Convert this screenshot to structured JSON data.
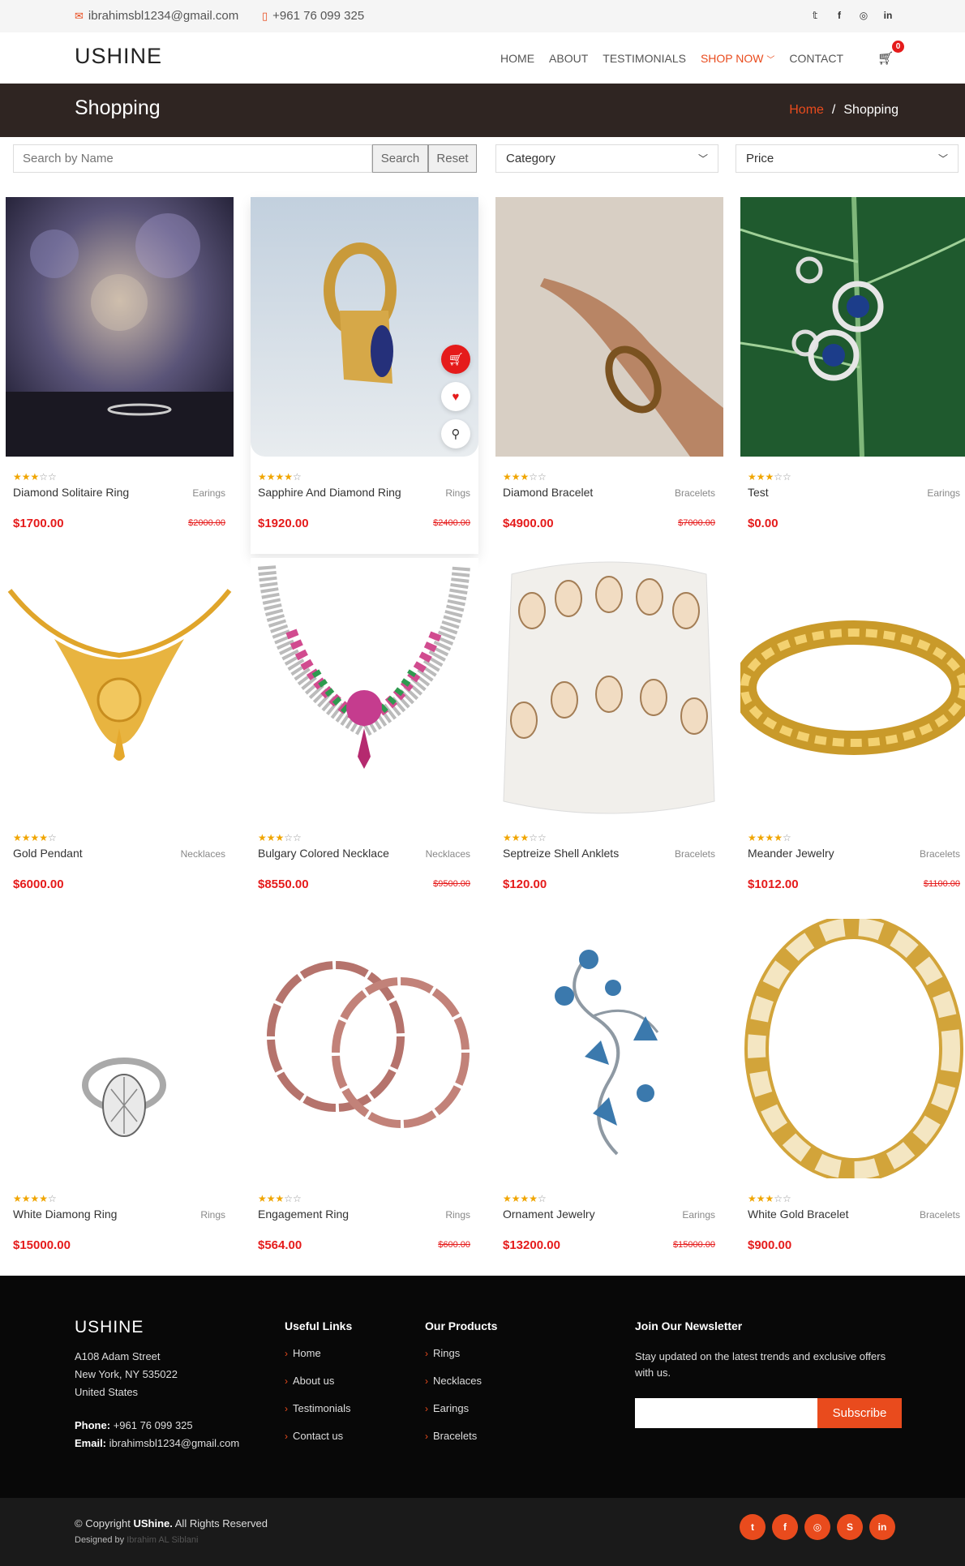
{
  "topbar": {
    "email": "ibrahimsbl1234@gmail.com",
    "phone": "+961 76 099 325",
    "social": [
      "twitter-icon",
      "facebook-icon",
      "instagram-icon",
      "linkedin-icon"
    ]
  },
  "header": {
    "logo": "USHINE",
    "nav": [
      {
        "label": "HOME",
        "active": false
      },
      {
        "label": "ABOUT",
        "active": false
      },
      {
        "label": "TESTIMONIALS",
        "active": false
      },
      {
        "label": "SHOP NOW",
        "active": true
      },
      {
        "label": "CONTACT",
        "active": false
      }
    ],
    "cart_count": "0"
  },
  "banner": {
    "title": "Shopping",
    "breadcrumb_home": "Home",
    "breadcrumb_sep": "/",
    "breadcrumb_current": "Shopping"
  },
  "filters": {
    "search_placeholder": "Search by Name",
    "search_button": "Search",
    "reset_button": "Reset",
    "category_label": "Category",
    "price_label": "Price"
  },
  "products": [
    {
      "name": "Diamond Solitaire Ring",
      "category": "Earings",
      "price": "$1700.00",
      "old_price": "$2000.00",
      "rating": 3
    },
    {
      "name": "Sapphire And Diamond Ring",
      "category": "Rings",
      "price": "$1920.00",
      "old_price": "$2400.00",
      "rating": 4
    },
    {
      "name": "Diamond Bracelet",
      "category": "Bracelets",
      "price": "$4900.00",
      "old_price": "$7000.00",
      "rating": 3
    },
    {
      "name": "Test",
      "category": "Earings",
      "price": "$0.00",
      "old_price": "",
      "rating": 3
    },
    {
      "name": "Gold Pendant",
      "category": "Necklaces",
      "price": "$6000.00",
      "old_price": "",
      "rating": 4
    },
    {
      "name": "Bulgary Colored Necklace",
      "category": "Necklaces",
      "price": "$8550.00",
      "old_price": "$9500.00",
      "rating": 3
    },
    {
      "name": "Septreize Shell Anklets",
      "category": "Bracelets",
      "price": "$120.00",
      "old_price": "",
      "rating": 3
    },
    {
      "name": "Meander Jewelry",
      "category": "Bracelets",
      "price": "$1012.00",
      "old_price": "$1100.00",
      "rating": 4
    },
    {
      "name": "White Diamong Ring",
      "category": "Rings",
      "price": "$15000.00",
      "old_price": "",
      "rating": 4
    },
    {
      "name": "Engagement Ring",
      "category": "Rings",
      "price": "$564.00",
      "old_price": "$600.00",
      "rating": 3
    },
    {
      "name": "Ornament Jewelry",
      "category": "Earings",
      "price": "$13200.00",
      "old_price": "$15000.00",
      "rating": 4
    },
    {
      "name": "White Gold Bracelet",
      "category": "Bracelets",
      "price": "$900.00",
      "old_price": "",
      "rating": 3
    }
  ],
  "footer": {
    "logo": "USHINE",
    "address": [
      "A108 Adam Street",
      "New York, NY 535022",
      "United States"
    ],
    "phone_label": "Phone:",
    "phone": "+961 76 099 325",
    "email_label": "Email:",
    "email": "ibrahimsbl1234@gmail.com",
    "useful_title": "Useful Links",
    "useful": [
      "Home",
      "About us",
      "Testimonials",
      "Contact us"
    ],
    "products_title": "Our Products",
    "products": [
      "Rings",
      "Necklaces",
      "Earings",
      "Bracelets"
    ],
    "newsletter_title": "Join Our Newsletter",
    "newsletter_text": "Stay updated on the latest trends and exclusive offers with us.",
    "subscribe": "Subscribe",
    "copyright_prefix": "© Copyright",
    "copyright_brand": "UShine.",
    "copyright_suffix": "All Rights Reserved",
    "designed_prefix": "Designed by",
    "designed_by": "Ibrahim AL Siblani",
    "social": [
      "twitter-icon",
      "facebook-icon",
      "instagram-icon",
      "skype-icon",
      "linkedin-icon"
    ]
  },
  "colors": {
    "accent": "#e94b1d",
    "price": "#e51b1b",
    "banner": "#2f2522",
    "footer": "#080808"
  }
}
